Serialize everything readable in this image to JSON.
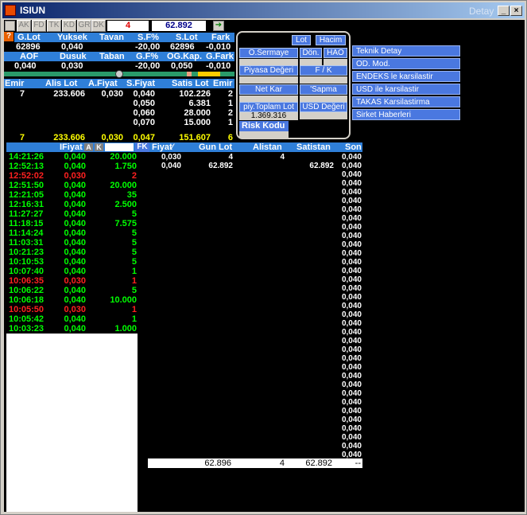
{
  "window": {
    "title": "ISIUN",
    "detail_label": "Detay"
  },
  "toolbar": {
    "tabs": [
      "AK",
      "FD",
      "TK",
      "KD",
      "GR",
      "DK"
    ],
    "count": "4",
    "price": "62.892"
  },
  "summary": {
    "headers1": [
      "G.Lot",
      "Yuksek",
      "Tavan",
      "S.F%",
      "S.Lot",
      "Fark"
    ],
    "values1": [
      "62896",
      "0,040",
      "",
      "-20,00",
      "62896",
      "-0,010"
    ],
    "headers2": [
      "AOF",
      "Dusuk",
      "Taban",
      "G.F%",
      "OG.Kap.",
      "G.Fark"
    ],
    "values2": [
      "0,040",
      "0,030",
      "",
      "-20,00",
      "0,050",
      "-0,010"
    ]
  },
  "depth": {
    "headers": [
      "Emir",
      "Alis Lot",
      "A.Fiyat",
      "S.Fiyat",
      "Satis Lot",
      "Emir"
    ],
    "rows": [
      [
        "7",
        "233.606",
        "0,030",
        "0,040",
        "102.226",
        "2"
      ],
      [
        "",
        "",
        "",
        "0,050",
        "6.381",
        "1"
      ],
      [
        "",
        "",
        "",
        "0,060",
        "28.000",
        "2"
      ],
      [
        "",
        "",
        "",
        "0,070",
        "15.000",
        "1"
      ]
    ],
    "totals": [
      "7",
      "233.606",
      "0,030",
      "0,047",
      "151.607",
      "6"
    ]
  },
  "popup": {
    "lot": "Lot",
    "hacim": "Hacim",
    "o_sermaye": "O.Sermaye",
    "don": "Dön.",
    "hao": "HAO",
    "piyasa_degeri": "Piyasa Değeri",
    "f_k": "F / K",
    "net_kar": "Net Kar",
    "sapma": "'Sapma",
    "piy_toplam_lot": "piy.Toplam Lot",
    "usd_degeri": "USD Değeri",
    "piy_toplam_lot_value": "1.369.316",
    "risk_kodu": "Risk Kodu"
  },
  "menu": [
    "Teknik Detay",
    "OD. Mod.",
    "ENDEKS le karsilastir",
    "USD ile karsilastir",
    "TAKAS Karsilastirma",
    "Sirket Haberleri"
  ],
  "trades": {
    "header": {
      "fiyat": "IFiyat",
      "a": "A",
      "k": "K",
      "fk": "FK"
    },
    "rows": [
      [
        "14:21:26",
        "0,040",
        "20.000",
        "green"
      ],
      [
        "12:52:13",
        "0,040",
        "1.750",
        "green"
      ],
      [
        "12:52:02",
        "0,030",
        "2",
        "red"
      ],
      [
        "12:51:50",
        "0,040",
        "20.000",
        "green"
      ],
      [
        "12:21:05",
        "0,040",
        "35",
        "green"
      ],
      [
        "12:16:31",
        "0,040",
        "2.500",
        "green"
      ],
      [
        "11:27:27",
        "0,040",
        "5",
        "green"
      ],
      [
        "11:18:15",
        "0,040",
        "7.575",
        "green"
      ],
      [
        "11:14:24",
        "0,040",
        "5",
        "green"
      ],
      [
        "11:03:31",
        "0,040",
        "5",
        "green"
      ],
      [
        "10:21:23",
        "0,040",
        "5",
        "green"
      ],
      [
        "10:10:53",
        "0,040",
        "5",
        "green"
      ],
      [
        "10:07:40",
        "0,040",
        "1",
        "green"
      ],
      [
        "10:06:35",
        "0,030",
        "1",
        "red"
      ],
      [
        "10:06:22",
        "0,040",
        "5",
        "green"
      ],
      [
        "10:06:18",
        "0,040",
        "10.000",
        "green"
      ],
      [
        "10:05:50",
        "0,030",
        "1",
        "red"
      ],
      [
        "10:05:42",
        "0,040",
        "1",
        "green"
      ],
      [
        "10:03:23",
        "0,040",
        "1.000",
        "green"
      ]
    ]
  },
  "volume": {
    "headers": [
      "Fiyat",
      "Gun Lot",
      "Alistan",
      "Satistan",
      "Son"
    ],
    "rows": [
      [
        "0,030",
        "4",
        "4",
        ""
      ],
      [
        "0,040",
        "62.892",
        "",
        "62.892"
      ]
    ],
    "son_value": "0,040",
    "son_count": 35,
    "footer": [
      "62.896",
      "4",
      "62.892",
      "--"
    ]
  },
  "colors": {
    "green": "#00ff00",
    "red": "#ff2020",
    "header_blue": "#2f7fd8",
    "yellow": "#ffff00"
  }
}
